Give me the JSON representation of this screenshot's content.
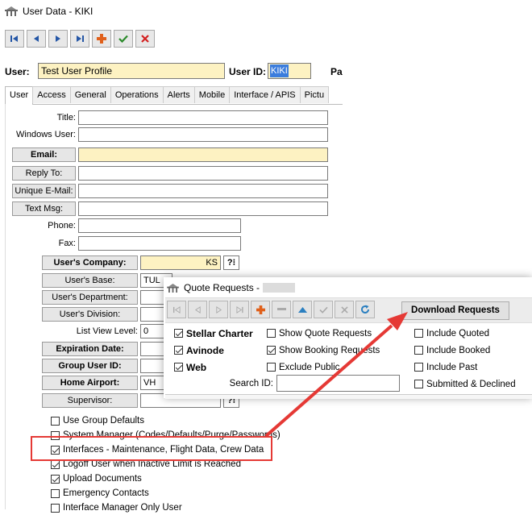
{
  "window": {
    "title": "User Data - KIKI"
  },
  "toolbar": {
    "buttons": [
      "first-record",
      "previous-record",
      "next-record",
      "last-record",
      "add-record",
      "save-record",
      "delete-record"
    ]
  },
  "header": {
    "user_label": "User:",
    "user_value": "Test User Profile",
    "user_id_label": "User ID:",
    "user_id_value": "KIKI",
    "extra_label": "Pa"
  },
  "tabs": [
    "User",
    "Access",
    "General",
    "Operations",
    "Alerts",
    "Mobile",
    "Interface / APIS",
    "Pictu"
  ],
  "form": {
    "title_label": "Title:",
    "windows_user_label": "Windows User:",
    "email_label": "Email:",
    "reply_to_label": "Reply To:",
    "unique_email_label": "Unique E-Mail:",
    "text_msg_label": "Text Msg:",
    "phone_label": "Phone:",
    "fax_label": "Fax:",
    "company_label": "User's Company:",
    "company_value": "KS",
    "base_label": "User's Base:",
    "base_value": "TUL",
    "department_label": "User's Department:",
    "division_label": "User's Division:",
    "list_view_level_label": "List View Level:",
    "list_view_level_value": "0",
    "expiration_label": "Expiration Date:",
    "group_user_label": "Group User ID:",
    "home_airport_label": "Home Airport:",
    "home_airport_value": "VH",
    "supervisor_label": "Supervisor:"
  },
  "checkboxes": [
    {
      "label": "Use Group Defaults",
      "checked": false
    },
    {
      "label": "System Manager (Codes/Defaults/Purge/Passwords)",
      "checked": false
    },
    {
      "label": "Interfaces - Maintenance, Flight Data, Crew Data",
      "checked": true
    },
    {
      "label": "Logoff User when Inactive Limit is Reached",
      "checked": true
    },
    {
      "label": "Upload Documents",
      "checked": true
    },
    {
      "label": "Emergency Contacts",
      "checked": false
    },
    {
      "label": "Interface Manager Only User",
      "checked": false
    }
  ],
  "popup": {
    "title": "Quote Requests -",
    "download_button": "Download Requests",
    "col1": [
      {
        "label": "Stellar Charter",
        "checked": true
      },
      {
        "label": "Avinode",
        "checked": true
      },
      {
        "label": "Web",
        "checked": true
      }
    ],
    "col2": [
      {
        "label": "Show Quote Requests",
        "checked": false
      },
      {
        "label": "Show Booking Requests",
        "checked": true
      },
      {
        "label": "Exclude Public",
        "checked": false
      }
    ],
    "col3": [
      {
        "label": "Include Quoted",
        "checked": false
      },
      {
        "label": "Include Booked",
        "checked": false
      },
      {
        "label": "Include Past",
        "checked": false
      },
      {
        "label": "Submitted & Declined",
        "checked": false
      }
    ],
    "search_label": "Search ID:"
  },
  "colors": {
    "highlight": "#e53935",
    "required_field": "#fdf2c2",
    "selection": "#3b7ddd"
  }
}
